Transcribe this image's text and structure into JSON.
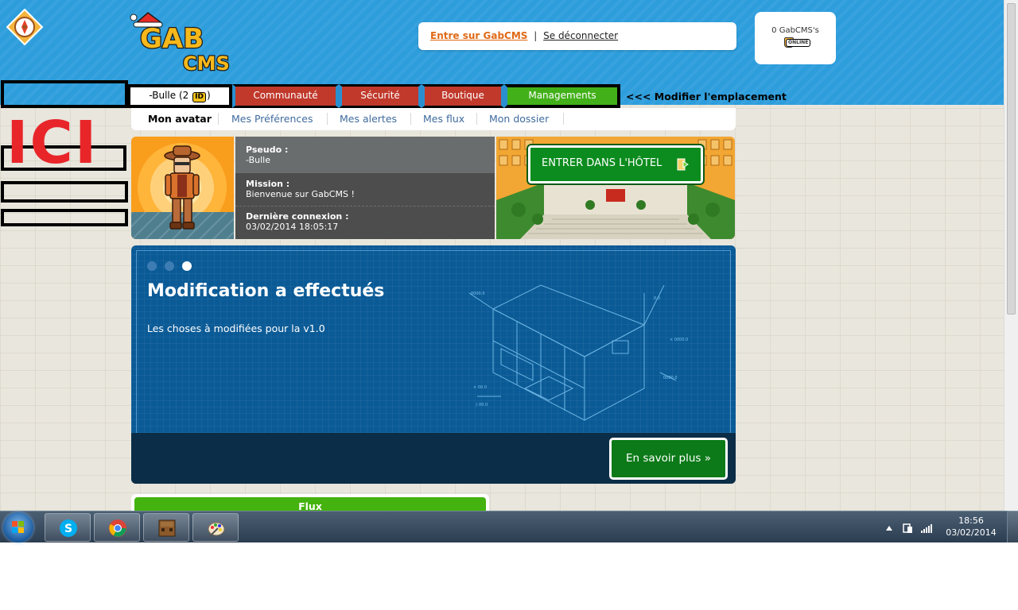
{
  "userbar": {
    "enter_link": "Entre sur GabCMS",
    "separator": "|",
    "logout_link": "Se déconnecter"
  },
  "credits": {
    "text": "0 GabCMS's",
    "status": "ONLINE"
  },
  "logo_text": "GAB CMS",
  "overlay_text": "ICI",
  "tabs": {
    "user_name": "-Bulle",
    "user_badge_count": "2",
    "badge_label": "ID",
    "communaute": "Communauté",
    "securite": "Sécurité",
    "boutique": "Boutique",
    "managements": "Managements"
  },
  "modif_note": "<<<  Modifier l'emplacement",
  "subnav": {
    "items": [
      "Mon avatar",
      "Mes Préférences",
      "Mes alertes",
      "Mes flux",
      "Mon dossier"
    ]
  },
  "profile": {
    "pseudo_label": "Pseudo :",
    "pseudo_value": "-Bulle",
    "mission_label": "Mission :",
    "mission_value": "Bienvenue sur GabCMS !",
    "last_login_label": "Dernière connexion :",
    "last_login_value": "03/02/2014 18:05:17"
  },
  "hotel_button": "ENTRER DANS L'HÔTEL",
  "banner": {
    "title": "Modification a effectués",
    "subtitle": "Les choses à modifiées pour la v1.0",
    "active_dot": 3,
    "dot_count": 3,
    "more_button": "En savoir plus »"
  },
  "flux": {
    "title": "Flux"
  },
  "taskbar": {
    "apps": [
      "skype-icon",
      "chrome-icon",
      "minecraft-icon",
      "paint-icon"
    ],
    "time": "18:56",
    "date": "03/02/2014"
  },
  "colors": {
    "header_blue": "#2d9ddc",
    "tab_red": "#c0392b",
    "tab_green": "#42b019",
    "banner_blue": "#0a5a96",
    "ici_red": "#e8262a",
    "enter_link_orange": "#e06a16"
  }
}
